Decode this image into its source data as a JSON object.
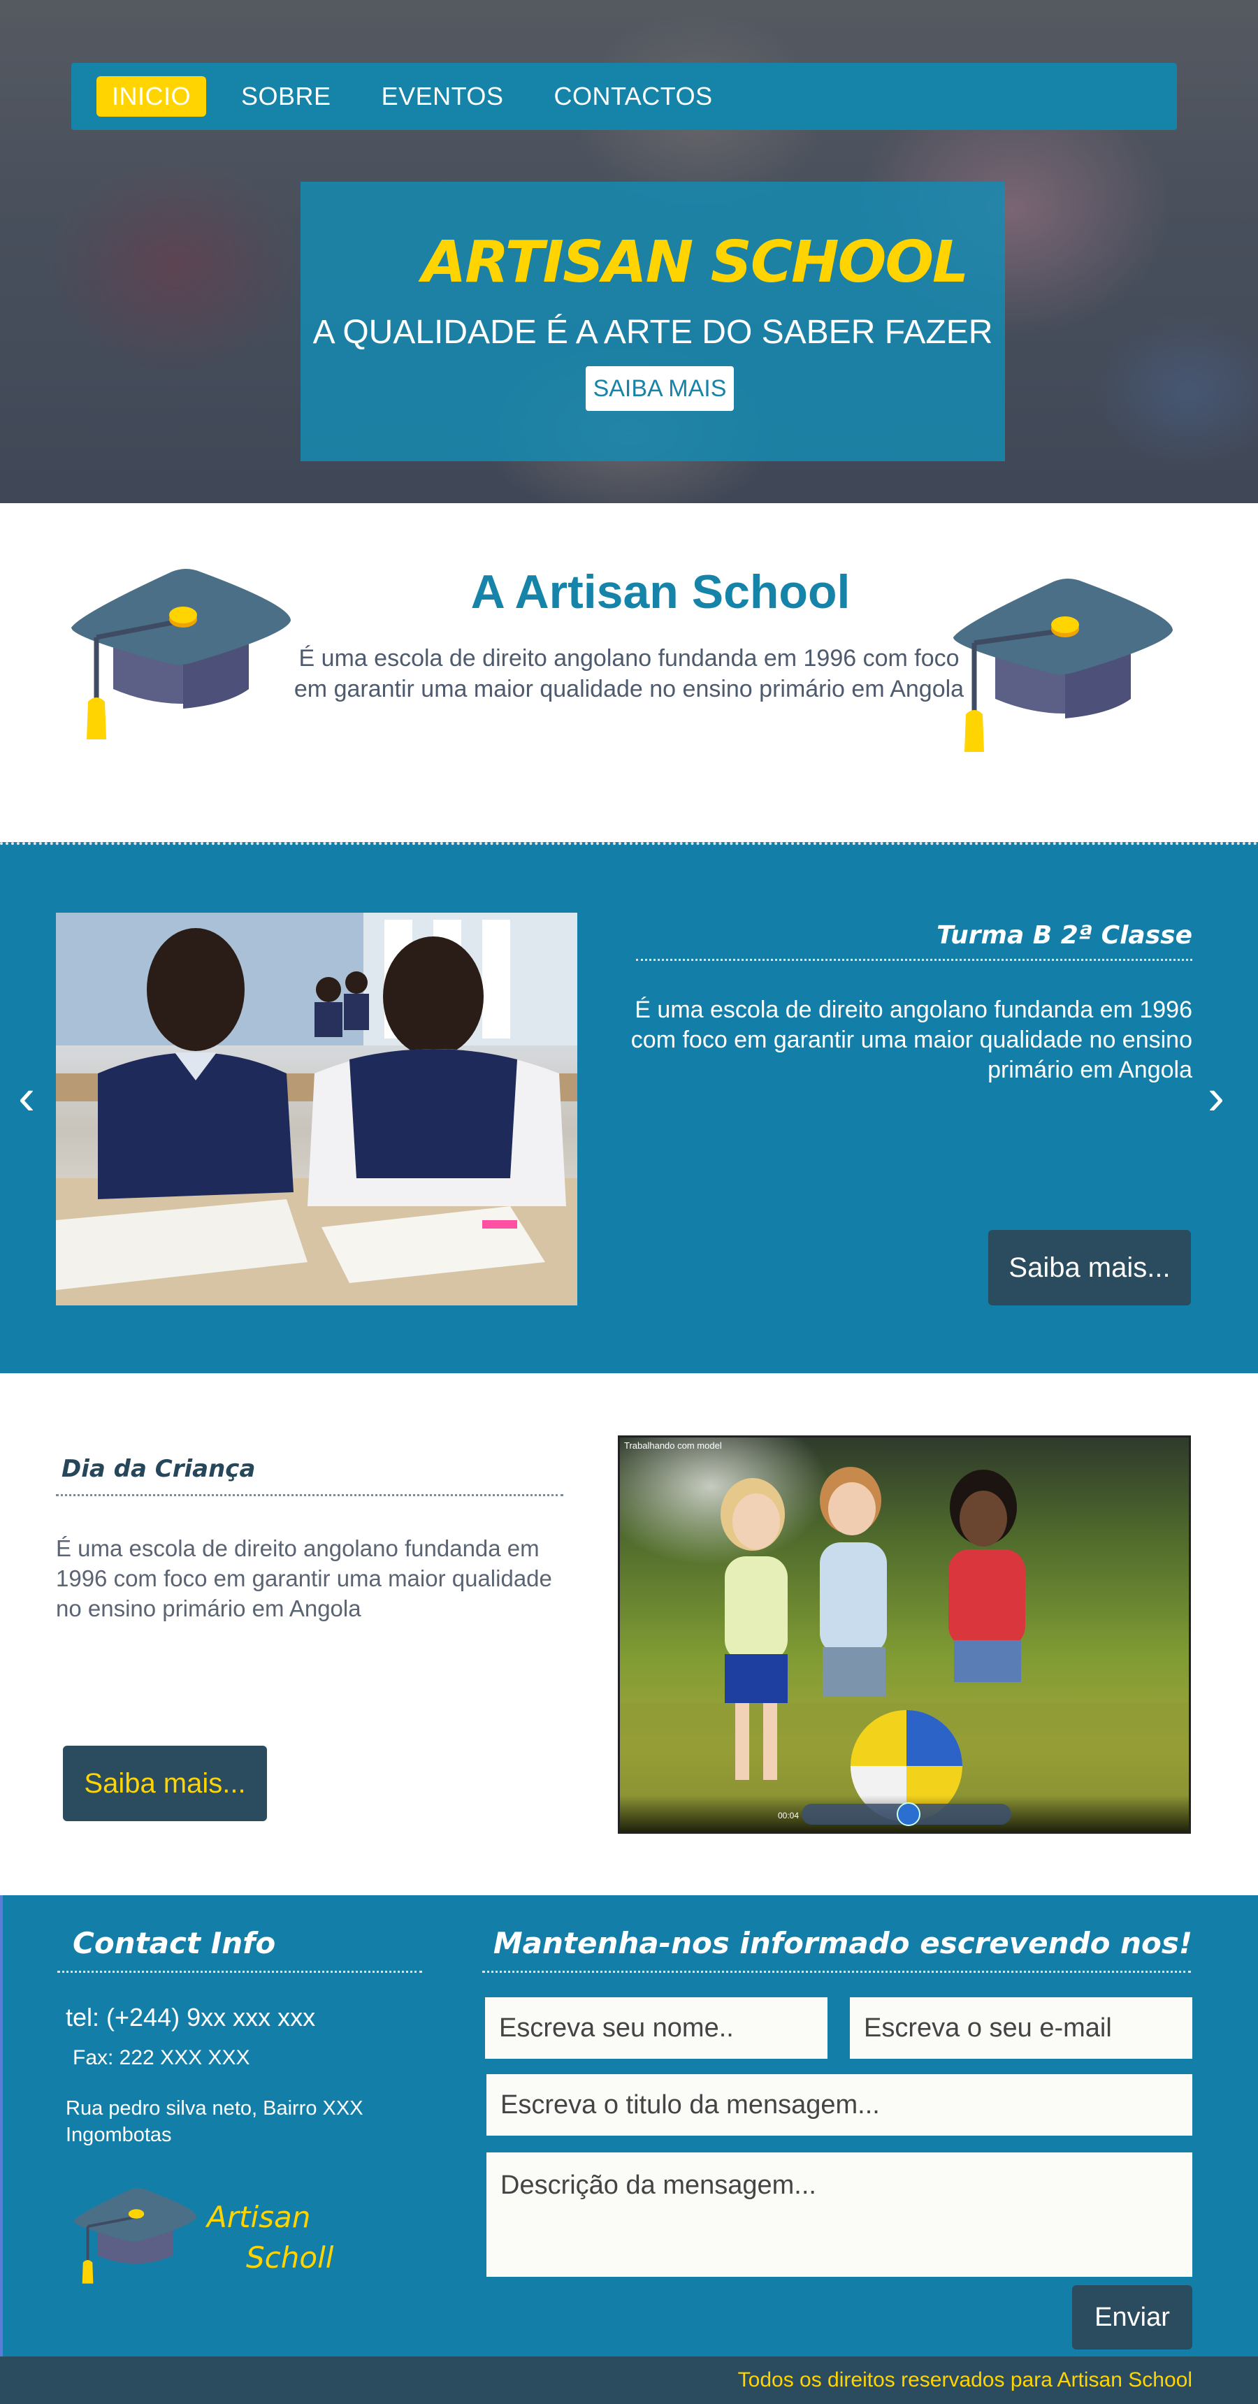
{
  "nav": {
    "items": [
      {
        "label": "INICIO"
      },
      {
        "label": "SOBRE"
      },
      {
        "label": "EVENTOS"
      },
      {
        "label": "CONTACTOS"
      }
    ]
  },
  "hero": {
    "title": "ARTISAN SCHOOL",
    "subtitle": "A QUALIDADE É A ARTE DO SABER FAZER",
    "button": "SAIBA MAIS"
  },
  "about": {
    "title": "A Artisan School",
    "text": "É uma escola de direito angolano  fundanda em 1996 com foco em garantir uma maior qualidade no ensino primário em Angola"
  },
  "turma": {
    "title": "Turma B 2ª Classe",
    "text": "É uma escola de direito angolano  fundanda em 1996 com foco em garantir uma maior qualidade no ensino primário em Angola",
    "button": "Saiba mais...",
    "prev_icon": "‹",
    "next_icon": "›"
  },
  "dia": {
    "title": "Dia da Criança",
    "text": "É uma escola de direito angolano  fundanda em 1996 com foco em garantir uma maior qualidade no ensino primário em Angola",
    "button": "Saiba mais...",
    "video_label": "Trabalhando com model",
    "video_time": "00:04"
  },
  "contact": {
    "title": "Contact Info",
    "tel": "tel: (+244) 9xx xxx xxx",
    "fax": "Fax: 222 XXX XXX",
    "address": "Rua pedro silva neto, Bairro XXX Ingombotas",
    "brand_line1": "Artisan",
    "brand_line2": "Scholl"
  },
  "form": {
    "title": "Mantenha-nos informado escrevendo nos!",
    "name_placeholder": "Escreva seu nome..",
    "email_placeholder": "Escreva o seu e-mail",
    "subject_placeholder": "Escreva o titulo da mensagem...",
    "message_placeholder": "Descrição da mensagem...",
    "submit": "Enviar"
  },
  "footer": {
    "copyright": "Todos os direitos reservados para Artisan School"
  },
  "colors": {
    "primary": "#1683a9",
    "accent": "#ffd400",
    "dark": "#2a4c5e",
    "text": "#4e5a6e"
  }
}
